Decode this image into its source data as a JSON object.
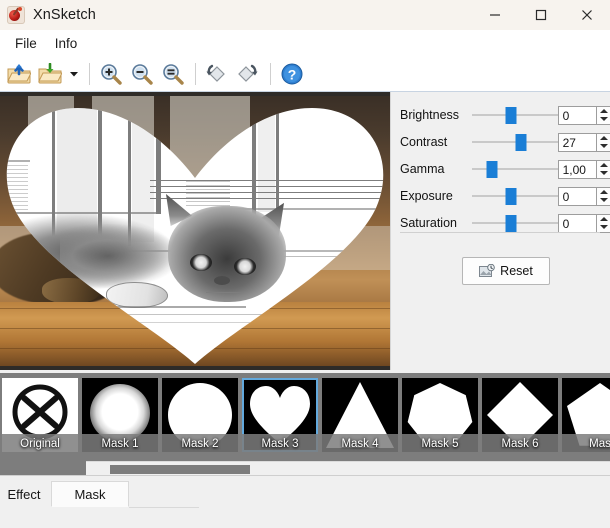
{
  "window": {
    "title": "XnSketch",
    "app_icon": "xnsketch-brush-icon",
    "minimize_label": "Minimize",
    "maximize_label": "Maximize",
    "close_label": "Close"
  },
  "menu": {
    "items": [
      {
        "label": "File"
      },
      {
        "label": "Info"
      }
    ]
  },
  "toolbar": {
    "buttons": [
      {
        "name": "open-file-button",
        "icon": "folder-open-icon",
        "label": "Open"
      },
      {
        "name": "save-file-button",
        "icon": "folder-save-icon",
        "label": "Save"
      },
      {
        "name": "save-dropdown-button",
        "icon": "chevron-down-icon",
        "label": "More save options"
      },
      {
        "name": "zoom-in-button",
        "icon": "magnifier-plus-icon",
        "label": "Zoom in"
      },
      {
        "name": "zoom-out-button",
        "icon": "magnifier-minus-icon",
        "label": "Zoom out"
      },
      {
        "name": "zoom-fit-button",
        "icon": "magnifier-equal-icon",
        "label": "Actual size"
      },
      {
        "name": "rotate-left-button",
        "icon": "rotate-left-icon",
        "label": "Rotate left"
      },
      {
        "name": "rotate-right-button",
        "icon": "rotate-right-icon",
        "label": "Rotate right"
      },
      {
        "name": "help-button",
        "icon": "question-circle-icon",
        "label": "Help"
      }
    ]
  },
  "preview": {
    "description": "Photo of a cat lying on a windowsill with a heart-shaped sketch mask applied"
  },
  "adjustments": {
    "controls": [
      {
        "label": "Brightness",
        "value": "0",
        "handle_pct": 50
      },
      {
        "label": "Contrast",
        "value": "27",
        "handle_pct": 63
      },
      {
        "label": "Gamma",
        "value": "1,00",
        "handle_pct": 26
      },
      {
        "label": "Exposure",
        "value": "0",
        "handle_pct": 50
      },
      {
        "label": "Saturation",
        "value": "0",
        "handle_pct": 50
      }
    ],
    "reset_label": "Reset",
    "reset_icon": "reset-image-icon"
  },
  "masks": {
    "items": [
      {
        "label": "Original",
        "shape": "original",
        "selected": false
      },
      {
        "label": "Mask 1",
        "shape": "blob",
        "selected": false
      },
      {
        "label": "Mask 2",
        "shape": "circle",
        "selected": false
      },
      {
        "label": "Mask 3",
        "shape": "heart",
        "selected": true
      },
      {
        "label": "Mask 4",
        "shape": "triangle",
        "selected": false
      },
      {
        "label": "Mask 5",
        "shape": "heptagon",
        "selected": false
      },
      {
        "label": "Mask 6",
        "shape": "diamond",
        "selected": false
      },
      {
        "label": "Mas",
        "shape": "pentagon",
        "selected": false
      }
    ],
    "scrollbar": "horizontal-scrollbar"
  },
  "tabs": {
    "items": [
      {
        "label": "Effect",
        "active": false
      },
      {
        "label": "Mask",
        "active": true
      }
    ]
  },
  "colors": {
    "accent": "#1a7ed6",
    "selection": "#62a9dd",
    "titlebar": "#f7f3ee",
    "panel": "#f0f0f0",
    "strip": "#7d7d7d"
  }
}
